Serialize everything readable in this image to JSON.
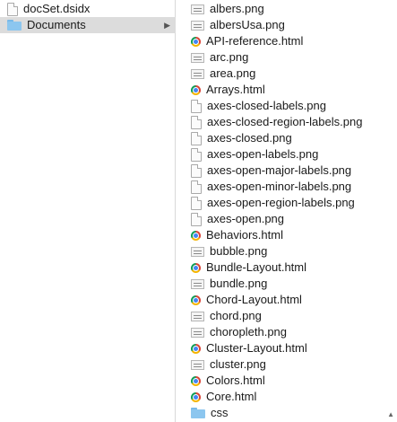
{
  "left_column": {
    "items": [
      {
        "name": "docSet.dsidx",
        "icon": "document-icon",
        "selected": false
      },
      {
        "name": "Documents",
        "icon": "folder-icon",
        "selected": true,
        "has_children": true
      }
    ],
    "chevron": "▶"
  },
  "right_column": {
    "items": [
      {
        "name": "albers.png",
        "icon": "png-icon"
      },
      {
        "name": "albersUsa.png",
        "icon": "png-icon"
      },
      {
        "name": "API-reference.html",
        "icon": "chrome-html-icon"
      },
      {
        "name": "arc.png",
        "icon": "png-icon"
      },
      {
        "name": "area.png",
        "icon": "png-icon"
      },
      {
        "name": "Arrays.html",
        "icon": "chrome-html-icon"
      },
      {
        "name": "axes-closed-labels.png",
        "icon": "document-icon"
      },
      {
        "name": "axes-closed-region-labels.png",
        "icon": "document-icon"
      },
      {
        "name": "axes-closed.png",
        "icon": "document-icon"
      },
      {
        "name": "axes-open-labels.png",
        "icon": "document-icon"
      },
      {
        "name": "axes-open-major-labels.png",
        "icon": "document-icon"
      },
      {
        "name": "axes-open-minor-labels.png",
        "icon": "document-icon"
      },
      {
        "name": "axes-open-region-labels.png",
        "icon": "document-icon"
      },
      {
        "name": "axes-open.png",
        "icon": "document-icon"
      },
      {
        "name": "Behaviors.html",
        "icon": "chrome-html-icon"
      },
      {
        "name": "bubble.png",
        "icon": "png-icon"
      },
      {
        "name": "Bundle-Layout.html",
        "icon": "chrome-html-icon"
      },
      {
        "name": "bundle.png",
        "icon": "png-icon"
      },
      {
        "name": "Chord-Layout.html",
        "icon": "chrome-html-icon"
      },
      {
        "name": "chord.png",
        "icon": "png-icon"
      },
      {
        "name": "choropleth.png",
        "icon": "png-icon"
      },
      {
        "name": "Cluster-Layout.html",
        "icon": "chrome-html-icon"
      },
      {
        "name": "cluster.png",
        "icon": "png-icon"
      },
      {
        "name": "Colors.html",
        "icon": "chrome-html-icon"
      },
      {
        "name": "Core.html",
        "icon": "chrome-html-icon"
      },
      {
        "name": "css",
        "icon": "folder-icon"
      }
    ],
    "scroll_caret": "▲"
  }
}
